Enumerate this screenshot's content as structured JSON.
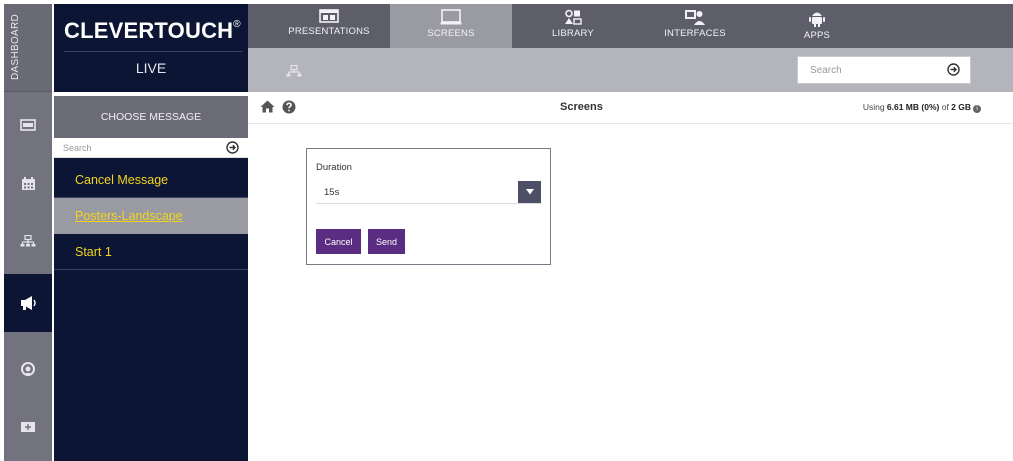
{
  "rail": {
    "label": "DASHBOARD",
    "items": [
      {
        "icon": "screen-icon",
        "active": false
      },
      {
        "icon": "calendar-icon",
        "active": false
      },
      {
        "icon": "network-icon",
        "active": false
      },
      {
        "icon": "megaphone-icon",
        "active": true
      },
      {
        "icon": "support-icon",
        "active": false
      },
      {
        "icon": "add-screen-icon",
        "active": false
      }
    ]
  },
  "brand": {
    "name": "CLEVERTOUCH",
    "mark": "®",
    "sub": "LIVE"
  },
  "tabs": [
    {
      "label": "PRESENTATIONS",
      "icon": "presentation-icon",
      "active": false
    },
    {
      "label": "SCREENS",
      "icon": "monitor-icon",
      "active": true
    },
    {
      "label": "LIBRARY",
      "icon": "library-icon",
      "active": false
    },
    {
      "label": "INTERFACES",
      "icon": "interfaces-icon",
      "active": false
    },
    {
      "label": "APPS",
      "icon": "android-icon",
      "active": false
    }
  ],
  "top_search": {
    "placeholder": "Search"
  },
  "panel": {
    "title": "CHOOSE MESSAGE",
    "search_placeholder": "Search",
    "messages": [
      {
        "label": "Cancel Message",
        "selected": false
      },
      {
        "label": "Posters-Landscape",
        "selected": true
      },
      {
        "label": "Start 1",
        "selected": false
      }
    ]
  },
  "content": {
    "title": "Screens",
    "usage_prefix": "Using ",
    "usage_amount": "6.61 MB (0%)",
    "usage_mid": " of ",
    "usage_total": "2 GB"
  },
  "dialog": {
    "label": "Duration",
    "value": "15s",
    "cancel_label": "Cancel",
    "send_label": "Send"
  },
  "colors": {
    "navy": "#0c1533",
    "accent_yellow": "#f2d41f",
    "button_purple": "#5a2d82",
    "tab_bar": "#5e5e6b",
    "active_tab": "#9a9aa3"
  }
}
